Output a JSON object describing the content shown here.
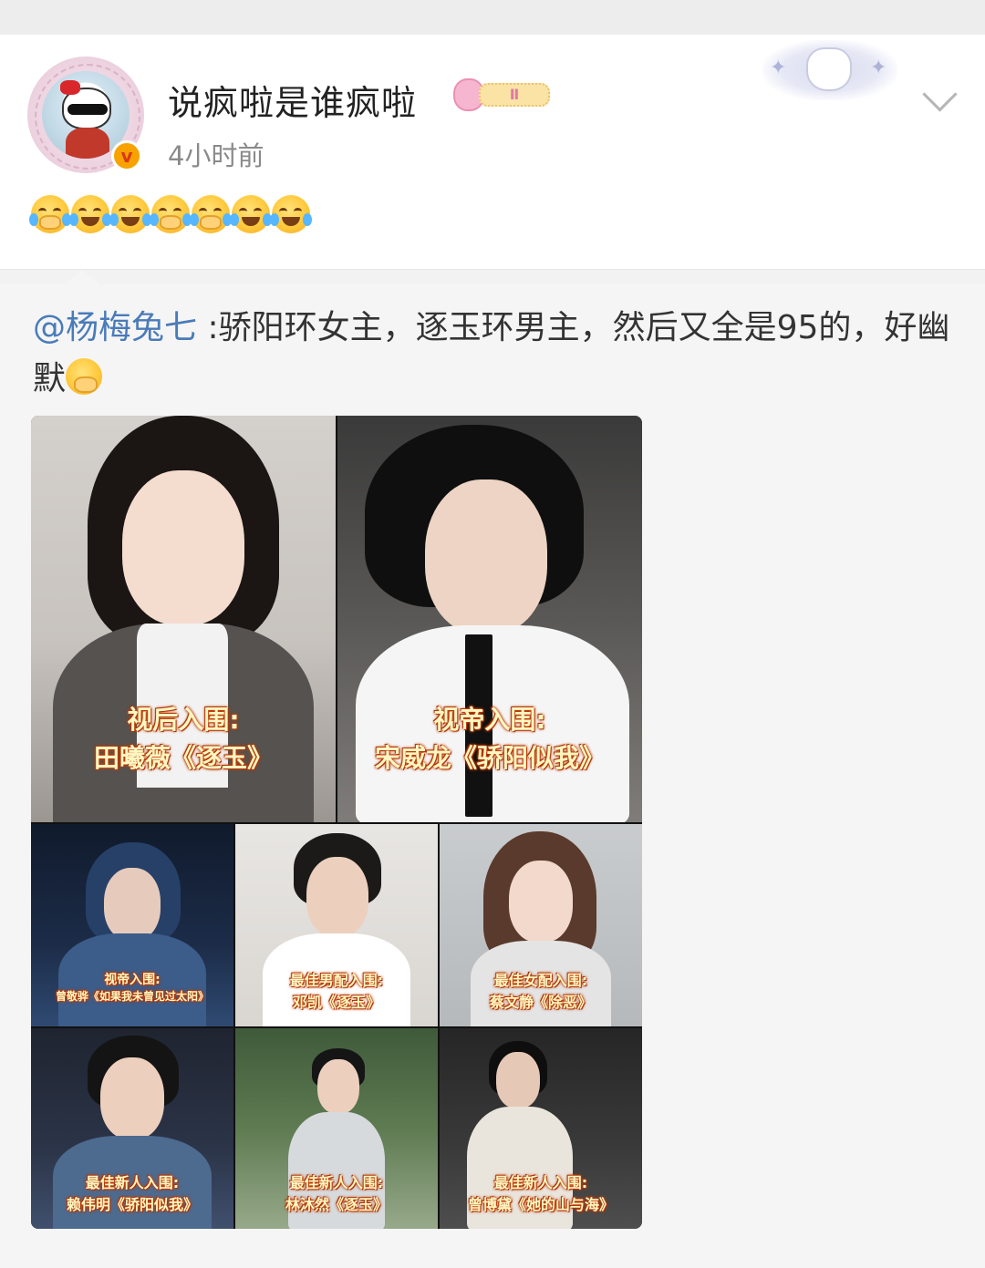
{
  "post": {
    "username": "说疯啦是谁疯啦",
    "medal_text": "Ⅱ",
    "verified_mark": "v",
    "timestamp": "4小时前",
    "emoji_sequence": [
      "crying-hands-emoji",
      "laugh-cry-emoji",
      "laugh-cry-emoji",
      "crying-hands-emoji",
      "crying-hands-emoji",
      "laugh-cry-emoji",
      "laugh-cry-emoji"
    ]
  },
  "repost": {
    "mention": "@杨梅兔七",
    "text": " :骄阳环女主，逐玉环男主，然后又全是95的，好幽默",
    "trailing_emoji": "crying-hands-emoji"
  },
  "image_grid": {
    "tiles": [
      {
        "line1": "视后入围:",
        "line2": "田曦薇《逐玉》"
      },
      {
        "line1": "视帝入围:",
        "line2": "宋威龙《骄阳似我》"
      },
      {
        "line1": "视帝入围:",
        "line2": "曾敬骅《如果我未曾见过太阳》"
      },
      {
        "line1": "最佳男配入围:",
        "line2": "邓凯《逐玉》"
      },
      {
        "line1": "最佳女配入围:",
        "line2": "蔡文静《除恶》"
      },
      {
        "line1": "最佳新人入围:",
        "line2": "赖伟明《骄阳似我》"
      },
      {
        "line1": "最佳新人入围:",
        "line2": "林沐然《逐玉》"
      },
      {
        "line1": "最佳新人入围:",
        "line2": "曾博黛《她的山与海》"
      }
    ]
  },
  "colors": {
    "mention": "#4a7bb8",
    "caption": "#fff7c2",
    "caption_outline": "#c2410c",
    "verified_badge": "#f7a200"
  }
}
